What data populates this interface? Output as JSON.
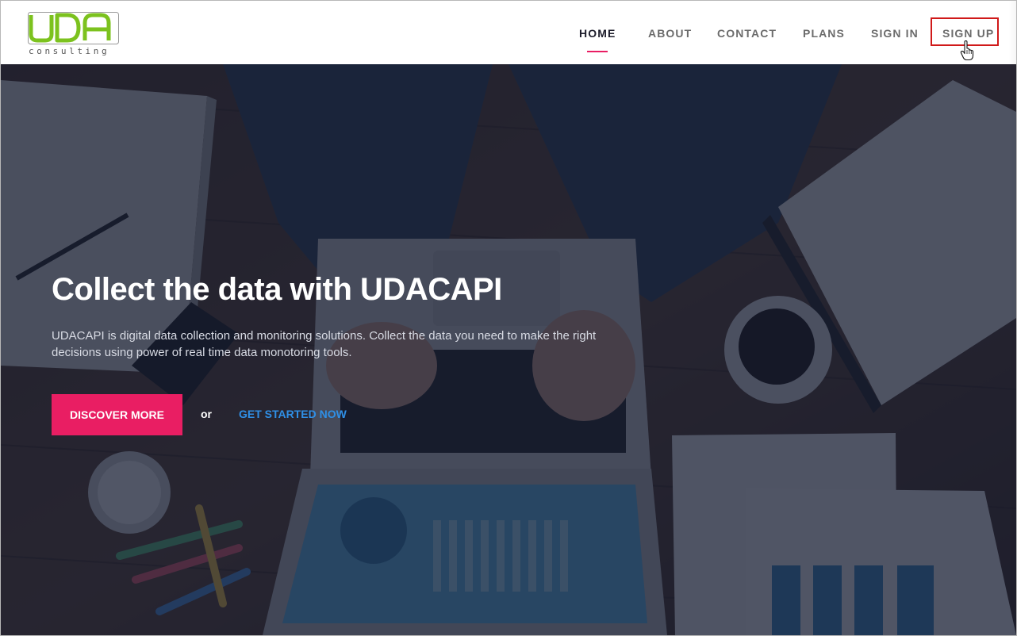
{
  "brand": {
    "logo_text": "UDA",
    "logo_subtext": "consulting",
    "logo_color": "#7cc21e"
  },
  "nav": {
    "items": [
      {
        "label": "HOME",
        "active": true
      },
      {
        "label": "ABOUT",
        "active": false
      },
      {
        "label": "CONTACT",
        "active": false
      },
      {
        "label": "PLANS",
        "active": false
      },
      {
        "label": "SIGN IN",
        "active": false
      },
      {
        "label": "SIGN UP",
        "active": false,
        "highlighted": true
      }
    ],
    "active_color": "#e91e63",
    "highlight_color": "#d01919"
  },
  "hero": {
    "title": "Collect the data with UDACAPI",
    "description": "UDACAPI is digital data collection and monitoring solutions. Collect the data you need to make the right decisions using power of real time data monotoring tools.",
    "primary_button": "DISCOVER MORE",
    "separator": "or",
    "secondary_link": "GET STARTED NOW",
    "primary_color": "#e91e63",
    "link_color": "#2f8fe6"
  }
}
